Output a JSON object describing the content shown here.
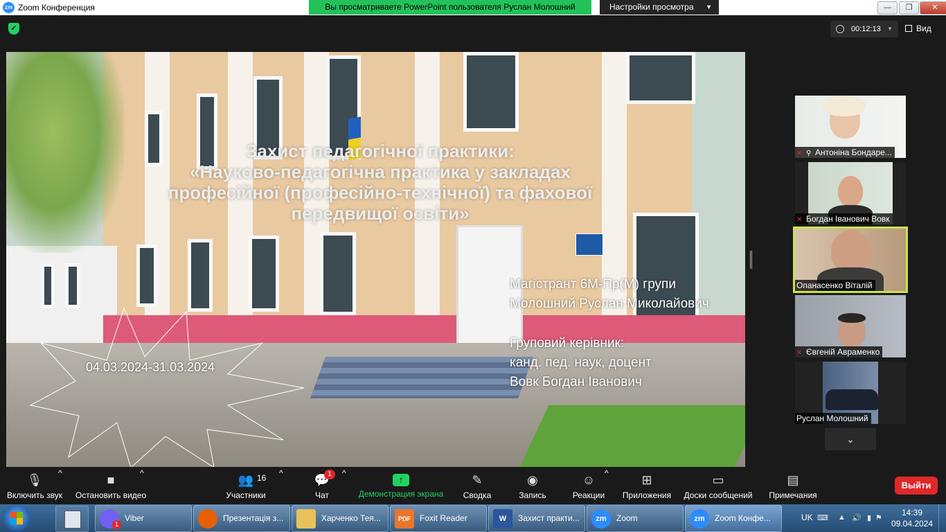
{
  "window": {
    "title": "Zoom Конференция",
    "logo_text": "zm",
    "share_banner": "Вы просматриваете PowerPoint пользователя Руслан Молошний",
    "view_settings": "Настройки просмотра",
    "controls": {
      "minimize": "—",
      "restore": "❐",
      "close": "✕"
    }
  },
  "topbar": {
    "timer": "00:12:13",
    "view_label": "Вид"
  },
  "slide": {
    "title_lines": [
      "Захист педагогічної практики:",
      "«Науково-педагогічна практика у закладах",
      "професійної (професійно-технічної) та фахової",
      "передвищої освіти»"
    ],
    "student_line1": "Магістрант 6М-Пр(М) групи",
    "student_line2": "Молошний Руслан Миколайович",
    "supervisor_line1": "Груповий керівник:",
    "supervisor_line2": "канд. пед. наук, доцент",
    "supervisor_line3": "Вовк Богдан Іванович",
    "dates": "04.03.2024-31.03.2024"
  },
  "participants": [
    {
      "name": "Антоніна Бондаре...",
      "muted": true,
      "pinned": true
    },
    {
      "name": "Богдан Іванович Вовк",
      "muted": true,
      "pinned": false
    },
    {
      "name": "Опанасенко Віталій",
      "muted": false,
      "pinned": false,
      "active_speaker": true
    },
    {
      "name": "Євгеній Авраменко",
      "muted": true,
      "pinned": false
    },
    {
      "name": "Руслан Молошний",
      "muted": false,
      "pinned": false
    }
  ],
  "toolbar": {
    "unmute": "Включить звук",
    "stop_video": "Остановить видео",
    "participants": "Участники",
    "participants_count": "16",
    "chat": "Чат",
    "chat_badge": "1",
    "share_screen": "Демонстрация экрана",
    "summary": "Сводка",
    "record": "Запись",
    "reactions": "Реакции",
    "apps": "Приложения",
    "whiteboards": "Доски сообщений",
    "notes": "Примечания",
    "leave": "Выйти"
  },
  "taskbar": {
    "tasks": [
      {
        "label": "Viber",
        "badge": "1",
        "icon_color": "#7360f2",
        "icon_text": ""
      },
      {
        "label": "Презентація з...",
        "icon_color": "#e66000",
        "icon_text": ""
      },
      {
        "label": "Харченко Тея...",
        "icon_color": "#e8c15a",
        "icon_text": ""
      },
      {
        "label": "Foxit Reader",
        "icon_color": "#e8762b",
        "icon_text": "PDF"
      },
      {
        "label": "Захист практи...",
        "icon_color": "#2b579a",
        "icon_text": "W"
      },
      {
        "label": "Zoom",
        "icon_color": "#2d8cff",
        "icon_text": "zm"
      },
      {
        "label": "Zoom Конфе...",
        "icon_color": "#2d8cff",
        "icon_text": "zm"
      }
    ],
    "language": "UK",
    "time": "14:39",
    "date": "09.04.2024"
  },
  "colors": {
    "zoom_green": "#23d160",
    "banner_green": "#23c15a",
    "leave_red": "#e02828",
    "active_speaker": "#c9e34c"
  }
}
